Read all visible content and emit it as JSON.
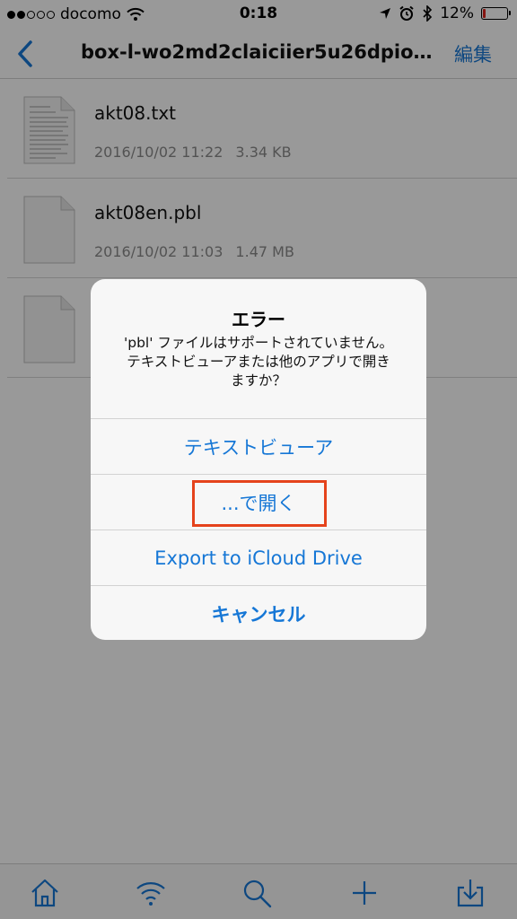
{
  "status_bar": {
    "carrier": "docomo",
    "time": "0:18",
    "battery_percent": "12%",
    "battery_level": 0.12
  },
  "nav": {
    "title": "box-l-wo2md2claiciier5u26dpioxl...",
    "edit_label": "編集"
  },
  "files": [
    {
      "name": "akt08.txt",
      "date": "2016/10/02 11:22",
      "size": "3.34 KB",
      "icon": "text-document-icon"
    },
    {
      "name": "akt08en.pbl",
      "date": "2016/10/02 11:03",
      "size": "1.47 MB",
      "icon": "blank-document-icon"
    },
    {
      "name": "",
      "date": "",
      "size": "",
      "icon": "blank-document-icon"
    }
  ],
  "alert": {
    "title": "エラー",
    "message": "'pbl' ファイルはサポートされていません。\nテキストビューアまたは他のアプリで開き\nますか？",
    "actions": [
      {
        "label": "テキストビューア"
      },
      {
        "label": "...で開く"
      },
      {
        "label": "Export to iCloud Drive"
      },
      {
        "label": "キャンセル"
      }
    ]
  },
  "tab_bar": {
    "items": [
      "home-icon",
      "wifi-icon",
      "search-icon",
      "add-icon",
      "download-icon"
    ]
  },
  "colors": {
    "accent": "#1677d6",
    "highlight": "#e5431c",
    "battery_low": "#e0261e"
  }
}
